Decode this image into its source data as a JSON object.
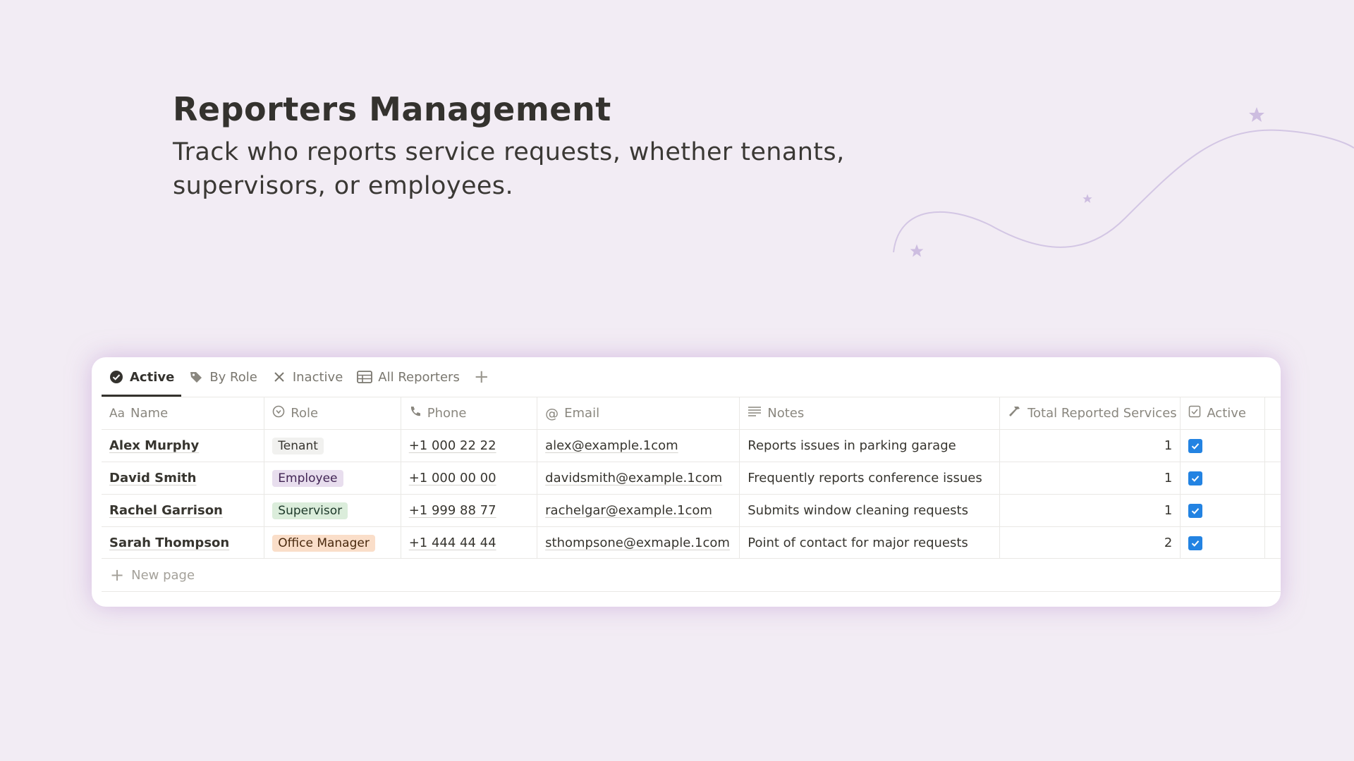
{
  "hero": {
    "title": "Reporters Management",
    "subtitle": "Track who reports service requests, whether tenants, supervisors, or employees."
  },
  "tabs": [
    {
      "label": "Active",
      "icon": "check-circle-icon",
      "active": true
    },
    {
      "label": "By Role",
      "icon": "tag-icon",
      "active": false
    },
    {
      "label": "Inactive",
      "icon": "x-icon",
      "active": false
    },
    {
      "label": "All Reporters",
      "icon": "table-icon",
      "active": false
    }
  ],
  "columns": [
    {
      "label": "Name",
      "icon": "text-aa-icon"
    },
    {
      "label": "Role",
      "icon": "select-icon"
    },
    {
      "label": "Phone",
      "icon": "phone-icon"
    },
    {
      "label": "Email",
      "icon": "at-icon"
    },
    {
      "label": "Notes",
      "icon": "lines-icon"
    },
    {
      "label": "Total Reported Services",
      "icon": "hammer-icon"
    },
    {
      "label": "Active",
      "icon": "checkbox-icon"
    }
  ],
  "rows": [
    {
      "name": "Alex Murphy",
      "role": "Tenant",
      "phone": "+1 000 22 22",
      "email": "alex@example.1com",
      "notes": "Reports issues in parking garage",
      "total": "1",
      "active": true
    },
    {
      "name": "David Smith",
      "role": "Employee",
      "phone": "+1 000 00 00",
      "email": "davidsmith@example.1com",
      "notes": "Frequently reports conference issues",
      "total": "1",
      "active": true
    },
    {
      "name": "Rachel Garrison",
      "role": "Supervisor",
      "phone": "+1 999 88 77",
      "email": "rachelgar@example.1com",
      "notes": "Submits window cleaning requests",
      "total": "1",
      "active": true
    },
    {
      "name": "Sarah Thompson",
      "role": "Office Manager",
      "phone": "+1 444 44 44",
      "email": "sthompsone@exmaple.1com",
      "notes": "Point of contact for major requests",
      "total": "2",
      "active": true
    }
  ],
  "role_colors": {
    "Tenant": {
      "bg": "#f1f1ef",
      "fg": "#37352f"
    },
    "Employee": {
      "bg": "#e8deee",
      "fg": "#412454"
    },
    "Supervisor": {
      "bg": "#dbeddb",
      "fg": "#1c3829"
    },
    "Office Manager": {
      "bg": "#fadec9",
      "fg": "#49290e"
    }
  },
  "new_page_label": "New page",
  "colors": {
    "background": "#f2ecf4",
    "checkbox": "#2383e2",
    "decoration": "#cdbde0"
  }
}
